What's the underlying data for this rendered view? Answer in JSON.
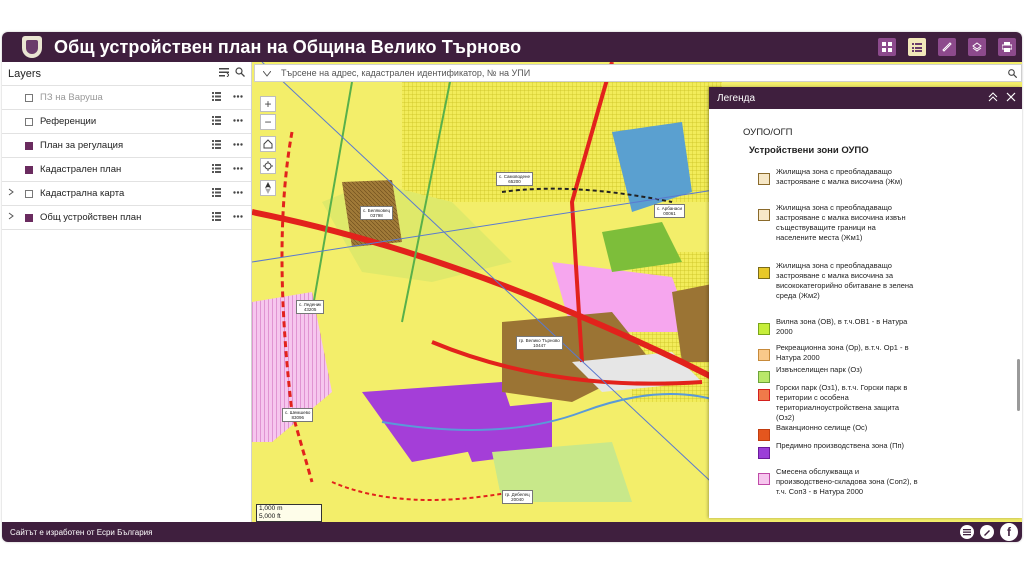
{
  "header": {
    "title": "Общ устройствен план на Община Велико Търново",
    "buttons": [
      "grid-icon",
      "list-icon",
      "ruler-icon",
      "layers-icon",
      "print-icon"
    ],
    "active_button": "list-icon",
    "color": "#3f1f3e"
  },
  "panel": {
    "title": "Layers",
    "layers": [
      {
        "name": "ПЗ на Варуша",
        "checked": false,
        "expandable": false,
        "dimmed": true
      },
      {
        "name": "Референции",
        "checked": false,
        "expandable": false,
        "dimmed": false
      },
      {
        "name": "План за регулация",
        "checked": true,
        "expandable": false,
        "dimmed": false
      },
      {
        "name": "Кадастрален план",
        "checked": true,
        "expandable": false,
        "dimmed": false
      },
      {
        "name": "Кадастрална карта",
        "checked": false,
        "expandable": true,
        "dimmed": false
      },
      {
        "name": "Общ устройствен план",
        "checked": true,
        "expandable": true,
        "dimmed": false
      }
    ]
  },
  "map": {
    "search_placeholder": "Търсене на адрес, кадастрален идентификатор, № на УПИ",
    "scale": [
      "1,000 m",
      "5,000 ft"
    ],
    "towns": [
      {
        "name": "с. Самоводене",
        "code": "65200"
      },
      {
        "name": "с. Беляковец",
        "code": "03798"
      },
      {
        "name": "с. Арбанаси",
        "code": "00061"
      },
      {
        "name": "с. Леденик",
        "code": "43205"
      },
      {
        "name": "гр. Велико Търново",
        "code": "10447"
      },
      {
        "name": "с. Шемшево",
        "code": "83096"
      },
      {
        "name": "гр. Дебелец",
        "code": "20040"
      }
    ]
  },
  "legend": {
    "title": "Легенда",
    "group": "ОУПО/ОГП",
    "subgroup": "Устройствени зони ОУПО",
    "items": [
      {
        "label": "Жилищна зона с преобладаващо застрояване с малка височина (Жм)",
        "color": "#f6e7c6",
        "stroke": "#8a6a2b"
      },
      {
        "label": "Жилищна зона с преобладаващо застрояване с малка височина извън съществуващите граници на населените места (Жм1)",
        "color": "#f7e8c8",
        "stroke": "#8a6a2b"
      },
      {
        "label": "Жилищна зона с преобладаващо застрояване с малка височина за висококатегорийно обитаване в зелена среда (Жм2)",
        "color": "#e8c828",
        "stroke": "#7a6b1a"
      },
      {
        "label": "Вилна зона (ОВ), в т.ч.ОВ1 - в Натура 2000",
        "color": "#c6ee3a",
        "stroke": "#7aa51a"
      },
      {
        "label": "Рекреационна зона (Ор), в.т.ч. Ор1 - в Натура 2000",
        "color": "#f9c98a",
        "stroke": "#c78a3a"
      },
      {
        "label": "Извънселищен парк (Оз)",
        "color": "#b9e86a",
        "stroke": "#6ea43a"
      },
      {
        "label": "Горски парк (Оз1), в.т.ч. Горски парк в територии с особена териториалноустройствена защита (Оз2)",
        "color": "#f07a4a",
        "stroke": "#d3201e"
      },
      {
        "label": "Ваканционно селище (Ос)",
        "color": "#e4561e",
        "stroke": "#c23d0f"
      },
      {
        "label": "Предимно производствена зона (Пп)",
        "color": "#9b3ed8",
        "stroke": "#6a1a9a"
      },
      {
        "label": "Смесена обслужваща и производствено-складова зона (Соп2), в т.ч. Соп3 - в Натура 2000",
        "color": "#f6c6ee",
        "stroke": "#c04aa8"
      }
    ]
  },
  "footer": {
    "text": "Сайтът е изработен от Есри България",
    "icons": [
      "esri-icon",
      "edit-icon",
      "facebook-icon"
    ],
    "facebook_glyph": "f"
  }
}
